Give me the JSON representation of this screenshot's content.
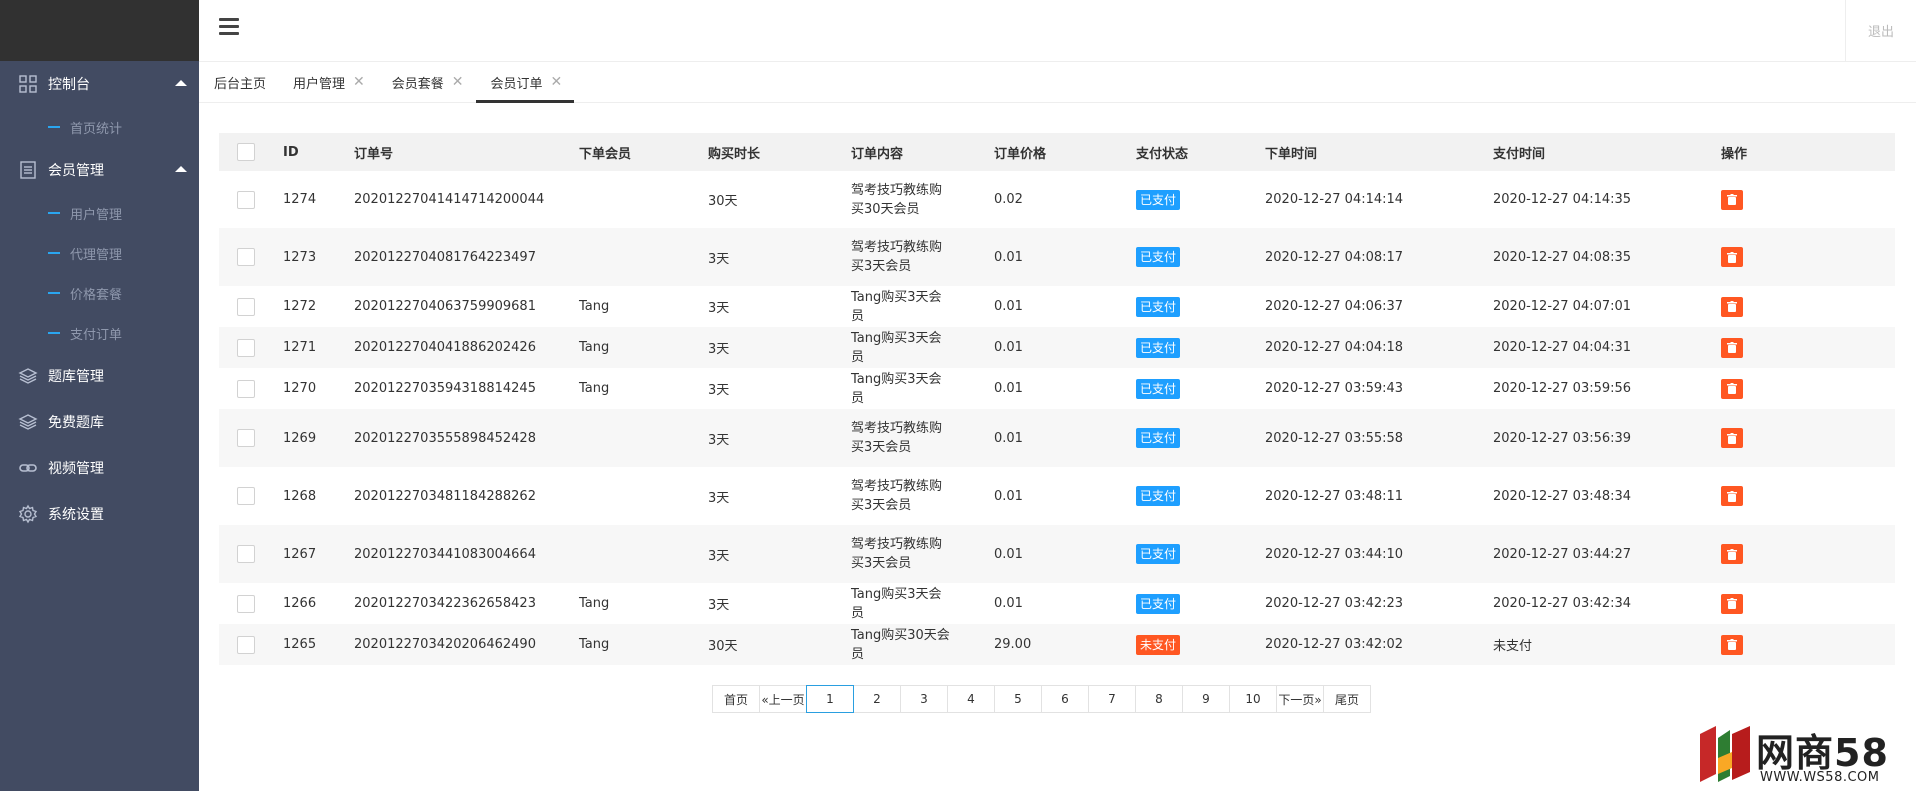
{
  "header": {
    "logout": "退出"
  },
  "sidebar": {
    "groups": [
      {
        "label": "控制台",
        "icon": "dashboard-icon",
        "sub": [
          "首页统计"
        ]
      },
      {
        "label": "会员管理",
        "icon": "list-icon",
        "sub": [
          "用户管理",
          "代理管理",
          "价格套餐",
          "支付订单"
        ]
      }
    ],
    "items": [
      {
        "label": "题库管理",
        "icon": "layers-icon"
      },
      {
        "label": "免费题库",
        "icon": "layers-icon"
      },
      {
        "label": "视频管理",
        "icon": "link-icon"
      },
      {
        "label": "系统设置",
        "icon": "gear-icon"
      }
    ]
  },
  "tabs": [
    {
      "label": "后台主页",
      "closable": false
    },
    {
      "label": "用户管理",
      "closable": true
    },
    {
      "label": "会员套餐",
      "closable": true
    },
    {
      "label": "会员订单",
      "closable": true,
      "active": true
    }
  ],
  "table": {
    "columns": [
      "ID",
      "订单号",
      "下单会员",
      "购买时长",
      "订单内容",
      "订单价格",
      "支付状态",
      "下单时间",
      "支付时间",
      "操作"
    ],
    "rows": [
      {
        "id": "1274",
        "order_no": "20201227041414714200044",
        "member": "",
        "duration": "30天",
        "content": "驾考技巧教练购买30天会员",
        "price": "0.02",
        "status": "已支付",
        "order_time": "2020-12-27 04:14:14",
        "pay_time": "2020-12-27 04:14:35",
        "h": 57
      },
      {
        "id": "1273",
        "order_no": "20201227040817642234​97",
        "member": "",
        "duration": "3天",
        "content": "驾考技巧教练购买3天会员",
        "price": "0.01",
        "status": "已支付",
        "order_time": "2020-12-27 04:08:17",
        "pay_time": "2020-12-27 04:08:35",
        "h": 58
      },
      {
        "id": "1272",
        "order_no": "20201227040637599096​81",
        "member": "Tang",
        "duration": "3天",
        "content": "Tang购买3天会员",
        "price": "0.01",
        "status": "已支付",
        "order_time": "2020-12-27 04:06:37",
        "pay_time": "2020-12-27 04:07:01",
        "h": 41
      },
      {
        "id": "1271",
        "order_no": "20201227040418862024​26",
        "member": "Tang",
        "duration": "3天",
        "content": "Tang购买3天会员",
        "price": "0.01",
        "status": "已支付",
        "order_time": "2020-12-27 04:04:18",
        "pay_time": "2020-12-27 04:04:31",
        "h": 41
      },
      {
        "id": "1270",
        "order_no": "20201227035943188142​45",
        "member": "Tang",
        "duration": "3天",
        "content": "Tang购买3天会员",
        "price": "0.01",
        "status": "已支付",
        "order_time": "2020-12-27 03:59:43",
        "pay_time": "2020-12-27 03:59:56",
        "h": 41
      },
      {
        "id": "1269",
        "order_no": "20201227035558984524​28",
        "member": "",
        "duration": "3天",
        "content": "驾考技巧教练购买3天会员",
        "price": "0.01",
        "status": "已支付",
        "order_time": "2020-12-27 03:55:58",
        "pay_time": "2020-12-27 03:56:39",
        "h": 58
      },
      {
        "id": "1268",
        "order_no": "20201227034811842882​62",
        "member": "",
        "duration": "3天",
        "content": "驾考技巧教练购买3天会员",
        "price": "0.01",
        "status": "已支付",
        "order_time": "2020-12-27 03:48:11",
        "pay_time": "2020-12-27 03:48:34",
        "h": 58
      },
      {
        "id": "1267",
        "order_no": "20201227034410830046​64",
        "member": "",
        "duration": "3天",
        "content": "驾考技巧教练购买3天会员",
        "price": "0.01",
        "status": "已支付",
        "order_time": "2020-12-27 03:44:10",
        "pay_time": "2020-12-27 03:44:27",
        "h": 58
      },
      {
        "id": "1266",
        "order_no": "20201227034223626584​23",
        "member": "Tang",
        "duration": "3天",
        "content": "Tang购买3天会员",
        "price": "0.01",
        "status": "已支付",
        "order_time": "2020-12-27 03:42:23",
        "pay_time": "2020-12-27 03:42:34",
        "h": 41
      },
      {
        "id": "1265",
        "order_no": "20201227034202064624​90",
        "member": "Tang",
        "duration": "30天",
        "content": "Tang购买30天会员",
        "price": "29.00",
        "status": "未支付",
        "order_time": "2020-12-27 03:42:02",
        "pay_time": "未支付",
        "h": 41
      }
    ]
  },
  "status_colors": {
    "已支付": "#1e9fff",
    "未支付": "#ff5722"
  },
  "pagination": {
    "first": "首页",
    "prev": "«上一页",
    "pages": [
      "1",
      "2",
      "3",
      "4",
      "5",
      "6",
      "7",
      "8",
      "9",
      "10"
    ],
    "current": "1",
    "next": "下一页»",
    "last": "尾页"
  },
  "watermark": {
    "title": "网商58",
    "sub": "WWW.WS58.COM"
  }
}
